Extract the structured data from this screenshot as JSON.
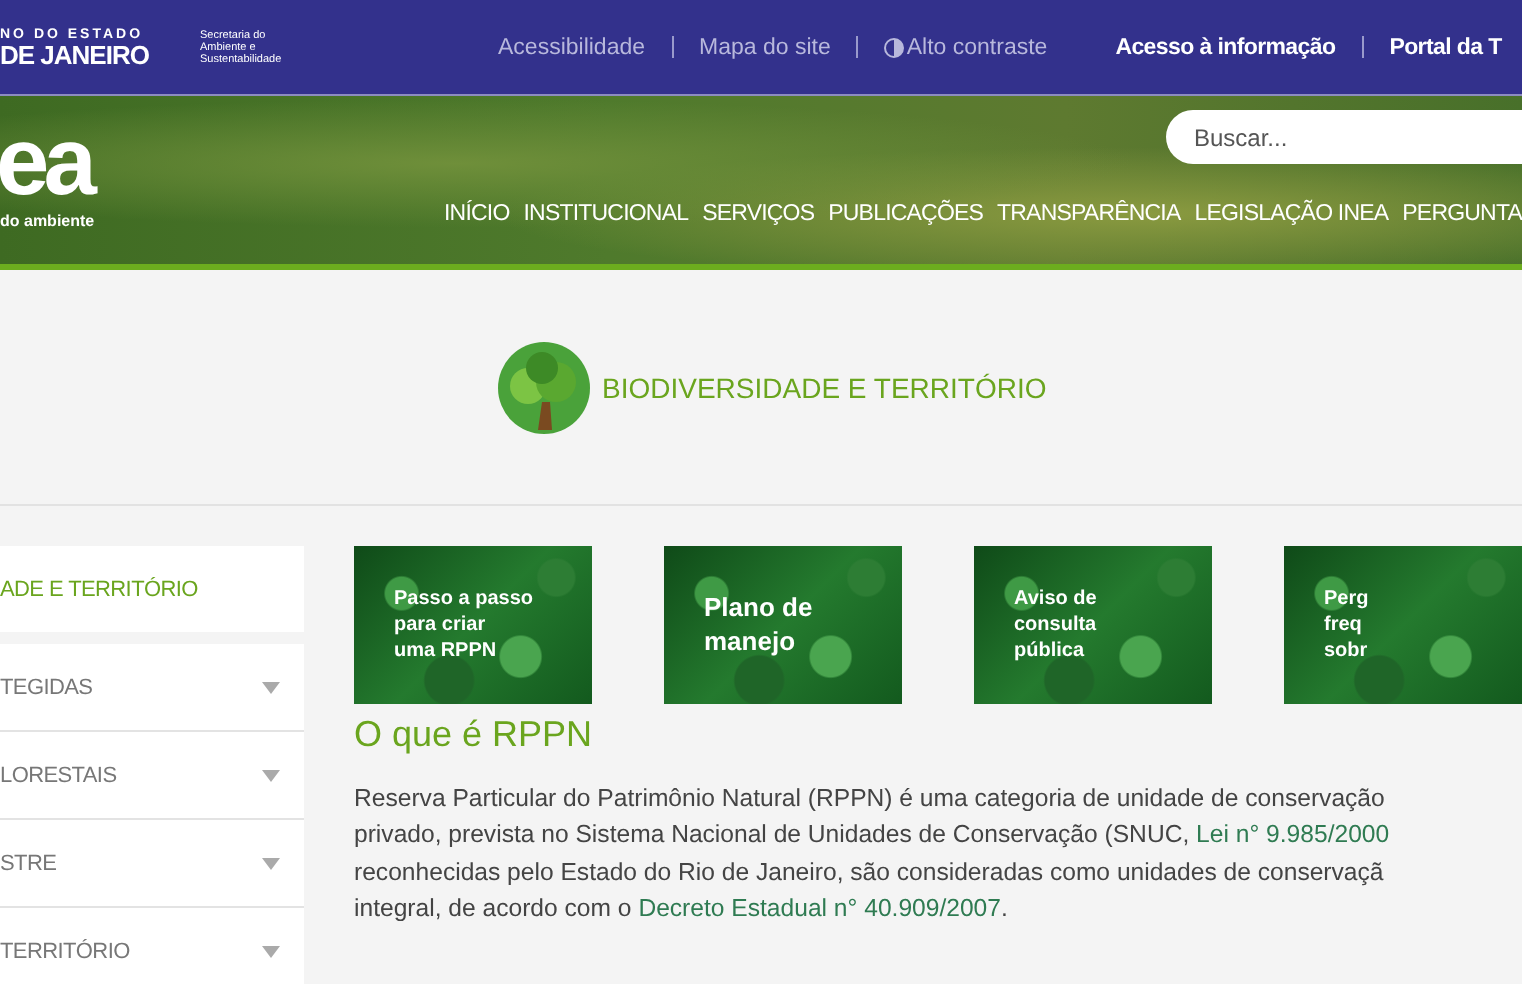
{
  "top_bar": {
    "state_logo": {
      "line_1": "NO DO ESTADO",
      "line_2": "DE JANEIRO"
    },
    "secretariat_logo": [
      "Secretaria do",
      "Ambiente e",
      "Sustentabilidade"
    ],
    "links": [
      {
        "label": "Acessibilidade",
        "kind": "plain"
      },
      {
        "label": "Mapa do site",
        "kind": "plain"
      },
      {
        "label": "Alto contraste",
        "kind": "contrast"
      }
    ],
    "right_links": [
      "Acesso à informação",
      "Portal da T"
    ]
  },
  "header": {
    "logo": {
      "mark": "ea",
      "tagline": "do ambiente"
    },
    "search": {
      "placeholder": "Buscar..."
    },
    "nav": [
      "INÍCIO",
      "INSTITUCIONAL",
      "SERVIÇOS",
      "PUBLICAÇÕES",
      "TRANSPARÊNCIA",
      "LEGISLAÇÃO INEA",
      "PERGUNTA"
    ]
  },
  "section_title": "BIODIVERSIDADE E TERRITÓRIO",
  "sidebar": {
    "items": [
      {
        "label": "ADE E TERRITÓRIO",
        "selected": true,
        "expandable": false
      },
      {
        "label": "TEGIDAS",
        "selected": false,
        "expandable": true
      },
      {
        "label": "LORESTAIS",
        "selected": false,
        "expandable": true
      },
      {
        "label": "STRE",
        "selected": false,
        "expandable": true
      },
      {
        "label": "TERRITÓRIO",
        "selected": false,
        "expandable": true
      }
    ]
  },
  "cards": [
    {
      "lines": [
        "Passo a passo",
        "para criar",
        "uma RPPN"
      ]
    },
    {
      "lines": [
        "Plano de",
        "manejo"
      ]
    },
    {
      "lines": [
        "Aviso de",
        "consulta",
        "pública"
      ]
    },
    {
      "lines": [
        "Perg",
        "freq",
        "sobr"
      ]
    }
  ],
  "article": {
    "heading": "O que é RPPN",
    "lines": [
      [
        {
          "kind": "text",
          "text": "Reserva Particular do Patrimônio Natural (RPPN) é uma categoria de unidade de conservação"
        }
      ],
      [
        {
          "kind": "text",
          "text": "privado, prevista no Sistema Nacional de Unidades de Conservação (SNUC, "
        },
        {
          "kind": "link",
          "text": "Lei n° 9.985/2000"
        }
      ],
      [
        {
          "kind": "text",
          "text": "reconhecidas pelo Estado do Rio de Janeiro, são consideradas como unidades de conservaçã"
        }
      ],
      [
        {
          "kind": "text",
          "text": "integral, de acordo com o "
        },
        {
          "kind": "link",
          "text": "Decreto Estadual n° 40.909/2007"
        },
        {
          "kind": "text",
          "text": "."
        }
      ]
    ]
  }
}
